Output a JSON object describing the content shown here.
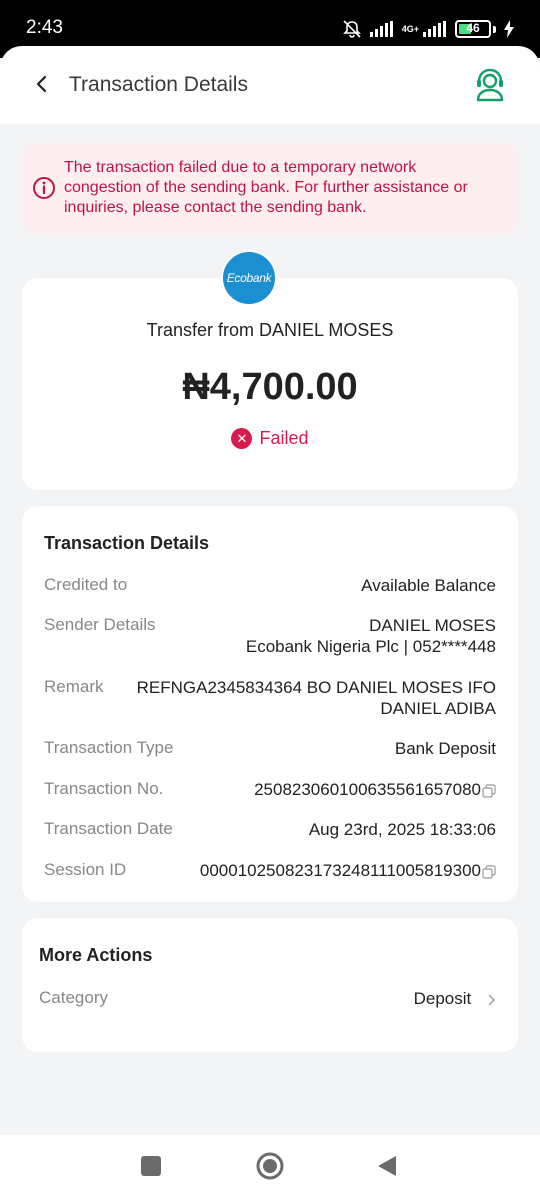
{
  "status_bar": {
    "time": "2:43",
    "network": "4G+",
    "battery": "46"
  },
  "header": {
    "title": "Transaction Details"
  },
  "alert": {
    "message": "The transaction failed due to a temporary network congestion of the sending bank. For further assistance or inquiries, please contact the sending bank."
  },
  "summary": {
    "bank_logo_text": "Ecobank",
    "title": "Transfer from DANIEL MOSES",
    "amount": "₦4,700.00",
    "status": "Failed"
  },
  "details": {
    "title": "Transaction Details",
    "rows": [
      {
        "label": "Credited to",
        "value": "Available Balance"
      },
      {
        "label": "Sender Details",
        "value": "DANIEL MOSES",
        "value2": "Ecobank Nigeria Plc | 052****448"
      },
      {
        "label": "Remark",
        "value": "REFNGA2345834364 BO DANIEL MOSES IFO",
        "value2": "DANIEL ADIBA"
      },
      {
        "label": "Transaction Type",
        "value": "Bank Deposit"
      },
      {
        "label": "Transaction No.",
        "value": "250823060100635561657080"
      },
      {
        "label": "Transaction Date",
        "value": "Aug 23rd, 2025 18:33:06"
      },
      {
        "label": "Session ID",
        "value": "000010250823173248111005819300"
      }
    ]
  },
  "more_actions": {
    "title": "More Actions",
    "category_label": "Category",
    "category_value": "Deposit"
  },
  "colors": {
    "accent_green": "#12a06a",
    "error_red": "#d81b4f",
    "alert_bg": "#fdeef1",
    "bank_blue": "#1c8fd1"
  },
  "icons": [
    "back-arrow-icon",
    "customer-support-icon",
    "info-icon",
    "failed-x-icon",
    "copy-icon",
    "chevron-right-icon",
    "nav-recents-icon",
    "nav-home-icon",
    "nav-back-icon"
  ]
}
